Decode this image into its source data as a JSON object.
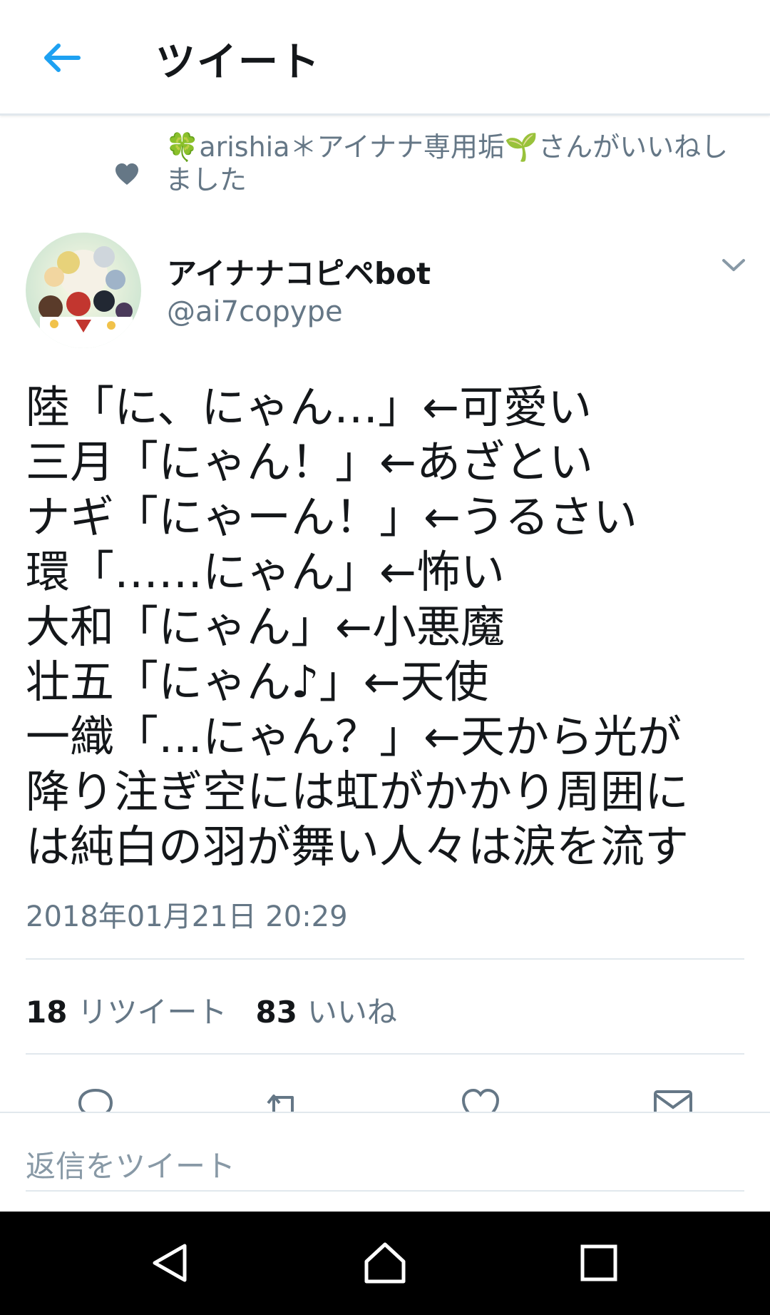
{
  "app_bar": {
    "title": "ツイート"
  },
  "social_context": {
    "text": "🍀arishia＊アイナナ専用垢🌱さんがいいねしました"
  },
  "author": {
    "name": "アイナナコピペbot",
    "handle": "@ai7copype"
  },
  "tweet": {
    "lines": [
      "陸「に、にゃん…」←可愛い",
      "三月「にゃん！」←あざとい",
      "ナギ「にゃーん！」←うるさい",
      "環「……にゃん」←怖い",
      "大和「にゃん」←小悪魔",
      "壮五「にゃん♪」←天使",
      "一織「…にゃん？」←天から光が",
      "降り注ぎ空には虹がかかり周囲に",
      "は純白の羽が舞い人々は涙を流す"
    ],
    "timestamp": "2018年01月21日 20:29"
  },
  "stats": {
    "retweets_count": "18",
    "retweets_label": "リツイート",
    "likes_count": "83",
    "likes_label": "いいね"
  },
  "composer": {
    "placeholder": "返信をツイート"
  },
  "colors": {
    "accent": "#1da1f2",
    "secondary_text": "#657786",
    "divider": "#e1e8ed"
  }
}
